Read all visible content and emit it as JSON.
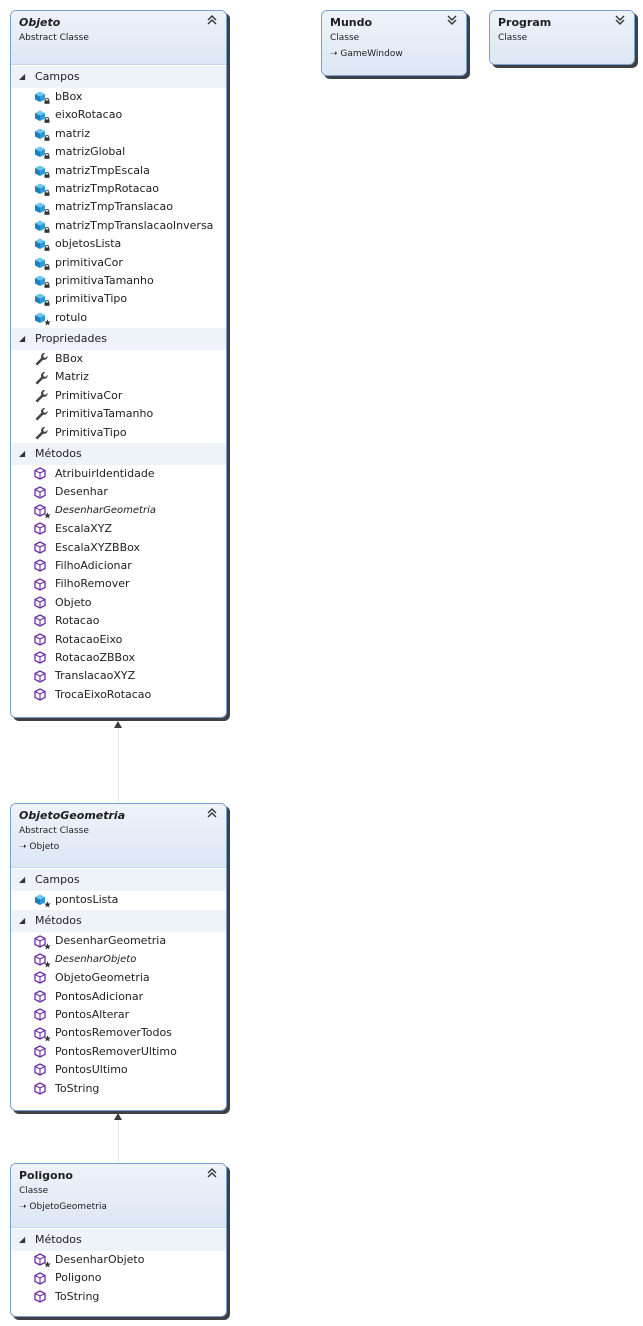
{
  "colors": {
    "border": "#7e9ecf",
    "header": "#dde6f3",
    "section": "#eef3f9",
    "shadow": "#3f3f46"
  },
  "objeto": {
    "title": "Objeto",
    "stereotype": "Abstract Classe",
    "sections": {
      "campos": "Campos",
      "propriedades": "Propriedades",
      "metodos": "Métodos"
    },
    "fields": [
      "bBox",
      "eixoRotacao",
      "matriz",
      "matrizGlobal",
      "matrizTmpEscala",
      "matrizTmpRotacao",
      "matrizTmpTranslacao",
      "matrizTmpTranslacaoInversa",
      "objetosLista",
      "primitivaCor",
      "primitivaTamanho",
      "primitivaTipo",
      "rotulo"
    ],
    "properties": [
      "BBox",
      "Matriz",
      "PrimitivaCor",
      "PrimitivaTamanho",
      "PrimitivaTipo"
    ],
    "methods": [
      "AtribuirIdentidade",
      "Desenhar",
      "DesenharGeometria",
      "EscalaXYZ",
      "EscalaXYZBBox",
      "FilhoAdicionar",
      "FilhoRemover",
      "Objeto",
      "Rotacao",
      "RotacaoEixo",
      "RotacaoZBBox",
      "TranslacaoXYZ",
      "TrocaEixoRotacao"
    ]
  },
  "mundo": {
    "title": "Mundo",
    "stereotype": "Classe",
    "base": "GameWindow"
  },
  "program": {
    "title": "Program",
    "stereotype": "Classe"
  },
  "objetoGeometria": {
    "title": "ObjetoGeometria",
    "stereotype": "Abstract Classe",
    "base": "Objeto",
    "sections": {
      "campos": "Campos",
      "metodos": "Métodos"
    },
    "fields": [
      "pontosLista"
    ],
    "methods": [
      "DesenharGeometria",
      "DesenharObjeto",
      "ObjetoGeometria",
      "PontosAdicionar",
      "PontosAlterar",
      "PontosRemoverTodos",
      "PontosRemoverUltimo",
      "PontosUltimo",
      "ToString"
    ]
  },
  "poligono": {
    "title": "Poligono",
    "stereotype": "Classe",
    "base": "ObjetoGeometria",
    "sections": {
      "metodos": "Métodos"
    },
    "methods": [
      "DesenharObjeto",
      "Poligono",
      "ToString"
    ]
  }
}
